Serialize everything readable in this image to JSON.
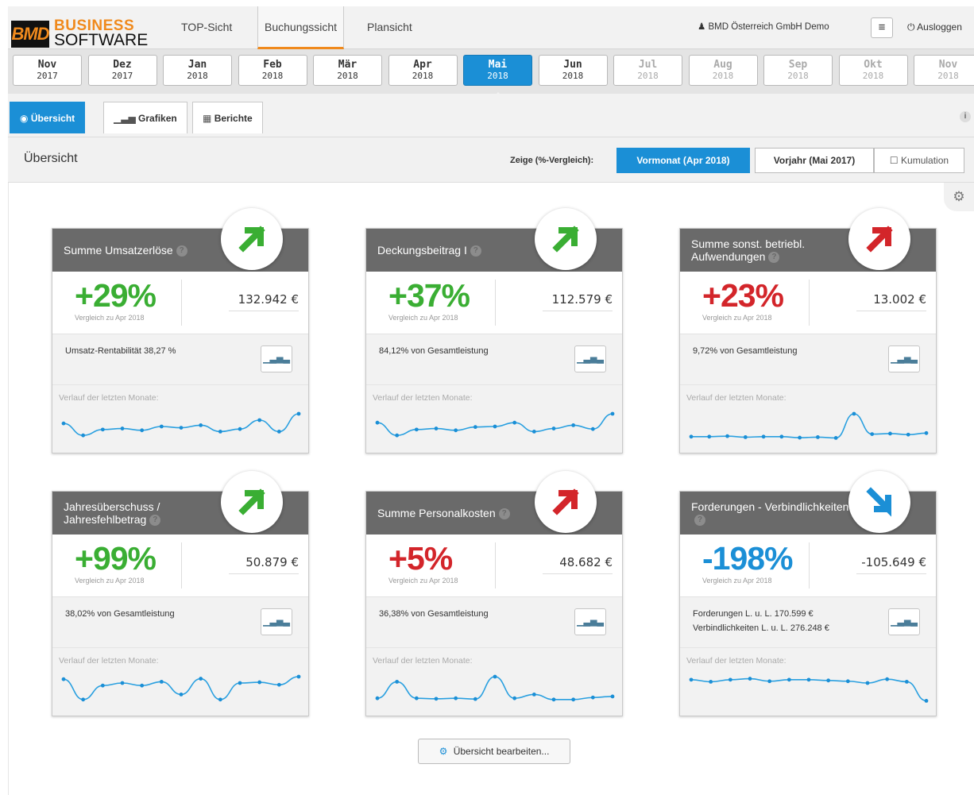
{
  "brand": {
    "logo_mark": "BMD",
    "logo_line1": "BUSINESS",
    "logo_line2": "SOFTWARE"
  },
  "nav": {
    "items": [
      "TOP-Sicht",
      "Buchungssicht",
      "Plansicht"
    ],
    "active": "Buchungssicht"
  },
  "user": {
    "company": "BMD Österreich GmbH Demo",
    "menu_icon": "hamburger-icon",
    "logout_label": "Ausloggen"
  },
  "months": [
    {
      "m": "Nov",
      "y": "2017",
      "state": "normal"
    },
    {
      "m": "Dez",
      "y": "2017",
      "state": "normal"
    },
    {
      "m": "Jan",
      "y": "2018",
      "state": "normal"
    },
    {
      "m": "Feb",
      "y": "2018",
      "state": "normal"
    },
    {
      "m": "Mär",
      "y": "2018",
      "state": "normal"
    },
    {
      "m": "Apr",
      "y": "2018",
      "state": "normal"
    },
    {
      "m": "Mai",
      "y": "2018",
      "state": "active"
    },
    {
      "m": "Jun",
      "y": "2018",
      "state": "normal"
    },
    {
      "m": "Jul",
      "y": "2018",
      "state": "future"
    },
    {
      "m": "Aug",
      "y": "2018",
      "state": "future"
    },
    {
      "m": "Sep",
      "y": "2018",
      "state": "future"
    },
    {
      "m": "Okt",
      "y": "2018",
      "state": "future"
    },
    {
      "m": "Nov",
      "y": "2018",
      "state": "future"
    }
  ],
  "tabs": [
    {
      "label": "Übersicht",
      "icon": "dashboard-icon",
      "active": true
    },
    {
      "label": "Grafiken",
      "icon": "bar-chart-icon",
      "active": false
    },
    {
      "label": "Berichte",
      "icon": "table-icon",
      "active": false
    }
  ],
  "header": {
    "title": "Übersicht",
    "compare_label": "Zeige (%-Vergleich):",
    "btn_vormonat": "Vormonat (Apr 2018)",
    "btn_vorjahr": "Vorjahr (Mai 2017)",
    "btn_kumulation": "Kumulation"
  },
  "colors": {
    "accent": "#1b8fd6",
    "up_good": "#3aae33",
    "up_bad": "#d3252a",
    "neutral": "#1b8fd6",
    "brand_orange": "#f08a1d"
  },
  "trend_label": "Verlauf der letzten Monate:",
  "cards": [
    {
      "title": "Summe Umsatzerlöse",
      "pct": "+29%",
      "pct_color": "#3aae33",
      "compare": "Vergleich zu Apr 2018",
      "amount": "132.942 €",
      "info_lines": [
        "Umsatz-Rentabilität 38,27 %"
      ],
      "arrow": "up-right",
      "arrow_color": "#3aae33",
      "trend": [
        0.62,
        0.15,
        0.38,
        0.42,
        0.35,
        0.5,
        0.45,
        0.55,
        0.3,
        0.4,
        0.75,
        0.3,
        1.0
      ]
    },
    {
      "title": "Deckungsbeitrag I",
      "pct": "+37%",
      "pct_color": "#3aae33",
      "compare": "Vergleich zu Apr 2018",
      "amount": "112.579 €",
      "info_lines": [
        "84,12% von Gesamtleistung"
      ],
      "arrow": "up-right",
      "arrow_color": "#3aae33",
      "trend": [
        0.65,
        0.15,
        0.38,
        0.42,
        0.35,
        0.48,
        0.5,
        0.65,
        0.3,
        0.42,
        0.55,
        0.4,
        1.0
      ]
    },
    {
      "title": "Summe sonst. betriebl. Aufwendungen",
      "pct": "+23%",
      "pct_color": "#d3252a",
      "compare": "Vergleich zu Apr 2018",
      "amount": "13.002 €",
      "info_lines": [
        "9,72% von Gesamtleistung"
      ],
      "arrow": "up-right",
      "arrow_color": "#d3252a",
      "trend": [
        0.1,
        0.1,
        0.12,
        0.08,
        0.1,
        0.1,
        0.06,
        0.08,
        0.05,
        1.0,
        0.2,
        0.22,
        0.18,
        0.24
      ]
    },
    {
      "title": "Jahresüberschuss / Jahresfehlbetrag",
      "pct": "+99%",
      "pct_color": "#3aae33",
      "compare": "Vergleich zu Apr 2018",
      "amount": "50.879 €",
      "info_lines": [
        "38,02% von Gesamtleistung"
      ],
      "arrow": "up-right",
      "arrow_color": "#3aae33",
      "trend": [
        0.9,
        0.1,
        0.65,
        0.75,
        0.65,
        0.8,
        0.3,
        0.92,
        0.1,
        0.75,
        0.78,
        0.68,
        1.0
      ]
    },
    {
      "title": "Summe Personalkosten",
      "pct": "+5%",
      "pct_color": "#d3252a",
      "compare": "Vergleich zu Apr 2018",
      "amount": "48.682 €",
      "info_lines": [
        "36,38% von Gesamtleistung"
      ],
      "arrow": "up-right",
      "arrow_color": "#d3252a",
      "trend": [
        0.15,
        0.8,
        0.15,
        0.13,
        0.15,
        0.12,
        1.0,
        0.15,
        0.3,
        0.1,
        0.1,
        0.18,
        0.22
      ]
    },
    {
      "title": "Forderungen - Verbindlichkeiten",
      "pct": "-198%",
      "pct_color": "#1b8fd6",
      "compare": "Vergleich zu Apr 2018",
      "amount": "-105.649 €",
      "info_lines": [
        "Forderungen L. u. L. 170.599 €",
        "Verbindlichkeiten L. u. L. 276.248 €"
      ],
      "arrow": "down-right",
      "arrow_color": "#1b8fd6",
      "trend": [
        0.88,
        0.8,
        0.88,
        0.92,
        0.82,
        0.88,
        0.88,
        0.85,
        0.82,
        0.75,
        0.9,
        0.8,
        0.05
      ]
    }
  ],
  "footer": {
    "edit_button": "Übersicht bearbeiten..."
  }
}
